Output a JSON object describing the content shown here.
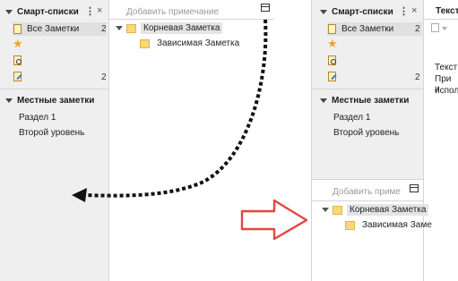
{
  "left": {
    "smart_lists": {
      "title": "Смарт-списки",
      "items": [
        {
          "label": "Все Заметки",
          "count": "2",
          "icon": "note-icon"
        },
        {
          "label": "",
          "count": "",
          "icon": "star-icon"
        },
        {
          "label": "",
          "count": "",
          "icon": "search-note-icon"
        },
        {
          "label": "",
          "count": "2",
          "icon": "edit-note-icon"
        }
      ]
    },
    "local_notes": {
      "title": "Местные заметки",
      "items": [
        "Раздел 1",
        "Второй уровень"
      ]
    },
    "placeholder": "Добавить примечание",
    "tree": [
      {
        "label": "Корневая Заметка",
        "level": 0
      },
      {
        "label": "Зависимая Заметка",
        "level": 1
      }
    ]
  },
  "right": {
    "smart_lists": {
      "title": "Смарт-списки",
      "items": [
        {
          "label": "Все Заметки",
          "count": "2",
          "icon": "note-icon"
        },
        {
          "label": "",
          "count": "",
          "icon": "star-icon"
        },
        {
          "label": "",
          "count": "",
          "icon": "search-note-icon"
        },
        {
          "label": "",
          "count": "2",
          "icon": "edit-note-icon"
        }
      ]
    },
    "local_notes": {
      "title": "Местные заметки",
      "items": [
        "Раздел 1",
        "Второй уровень"
      ]
    },
    "placeholder": "Добавить приме",
    "tree": [
      {
        "label": "Корневая Заметка",
        "level": 0
      },
      {
        "label": "Зависимая Заме",
        "level": 1
      }
    ],
    "editor": {
      "tab": "Текст",
      "lines": [
        "Текст",
        "При и",
        "испол"
      ]
    }
  },
  "colors": {
    "arrow_red": "#e5463f",
    "sidebar_bg": "#efefef",
    "folder": "#fad77a"
  }
}
